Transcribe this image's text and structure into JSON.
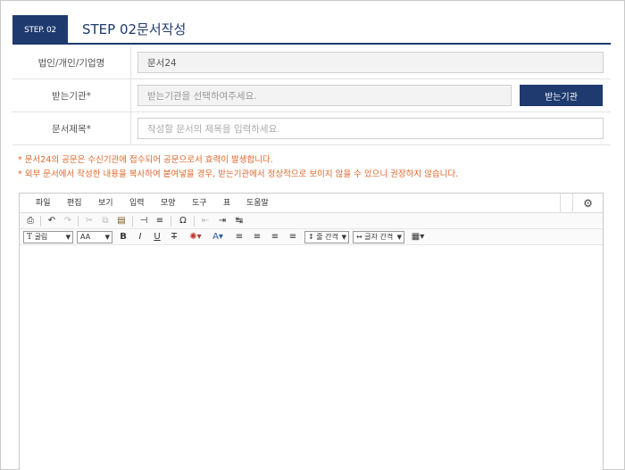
{
  "step": {
    "badge": "STEP. 02",
    "title": "STEP 02문서작성"
  },
  "form": {
    "org_label": "법인/개인/기업명",
    "org_value": "문서24",
    "agency_label": "받는기관*",
    "agency_placeholder": "받는기관을 선택하여주세요.",
    "agency_button": "받는기관",
    "title_label": "문서제목*",
    "title_placeholder": "작성할 문서의 제목을 입력하세요."
  },
  "notes": [
    "* 문서24의 공문은 수신기관에 접수되어 공문으로서 효력이 발생합니다.",
    "* 외부 문서에서 작성한 내용을 복사하여 붙여넣을 경우, 받는기관에서 정상적으로 보이지 않을 수 있으니 권장하지 않습니다."
  ],
  "editor": {
    "menu": [
      "파일",
      "편집",
      "보기",
      "입력",
      "모양",
      "도구",
      "표",
      "도움말"
    ],
    "font_family": "굴림",
    "font_size": "AA",
    "line_spacing": "줄 간격",
    "letter_spacing": "글자 간격",
    "icons": {
      "settings": "gear-icon"
    }
  }
}
